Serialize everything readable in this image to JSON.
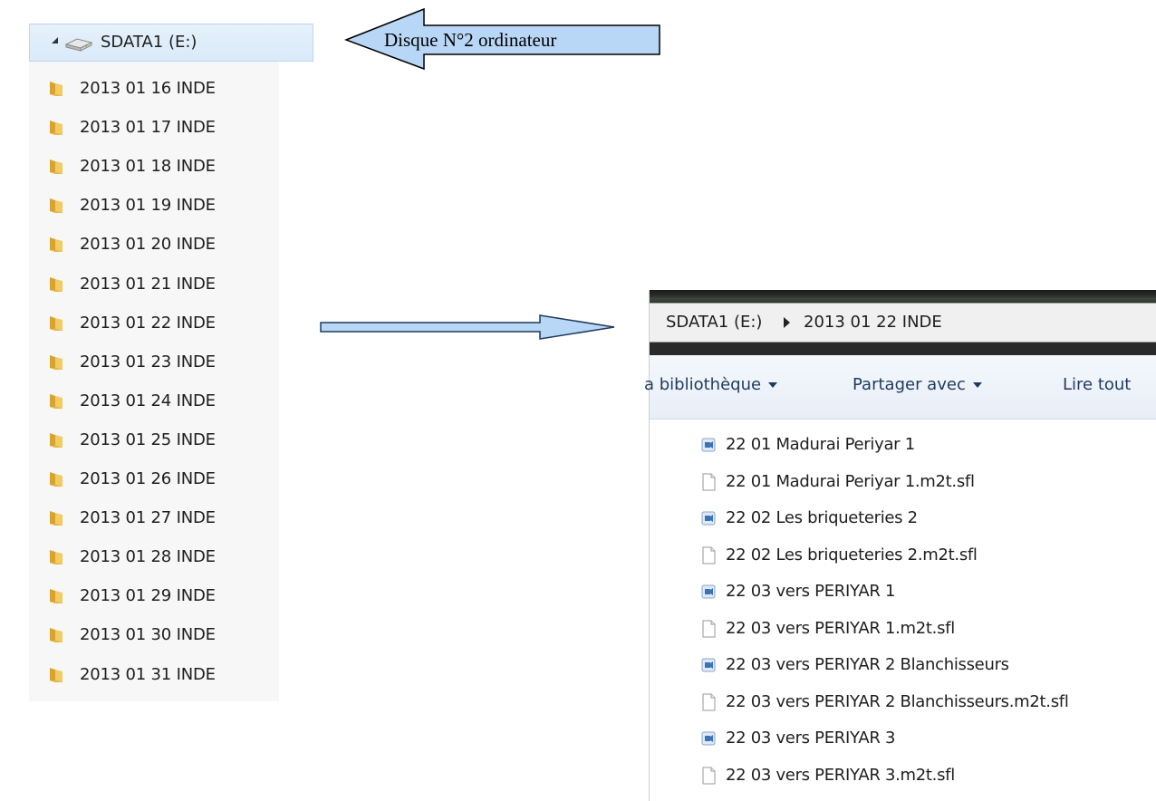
{
  "tree": {
    "drive_label": "SDATA1 (E:)",
    "folders": [
      "2013 01 16 INDE",
      "2013 01 17 INDE",
      "2013 01 18 INDE",
      "2013 01 19 INDE",
      "2013 01 20 INDE",
      "2013 01 21 INDE",
      "2013 01 22 INDE",
      "2013 01 23 INDE",
      "2013 01 24 INDE",
      "2013 01 25 INDE",
      "2013 01 26 INDE",
      "2013 01 27 INDE",
      "2013 01 28 INDE",
      "2013 01 29 INDE",
      "2013 01 30 INDE",
      "2013 01 31 INDE"
    ]
  },
  "callout": {
    "text": "Disque N°2 ordinateur"
  },
  "explorer": {
    "breadcrumb": [
      "SDATA1 (E:)",
      "2013 01 22 INDE"
    ],
    "toolbar": [
      "a bibliothèque",
      "Partager avec",
      "Lire tout"
    ],
    "files": [
      {
        "name": "22 01 Madurai Periyar 1",
        "icon": "video-file-icon"
      },
      {
        "name": "22 01 Madurai Periyar 1.m2t.sfl",
        "icon": "blank-file-icon"
      },
      {
        "name": "22 02 Les briqueteries 2",
        "icon": "video-file-icon"
      },
      {
        "name": "22 02 Les briqueteries 2.m2t.sfl",
        "icon": "blank-file-icon"
      },
      {
        "name": "22 03 vers PERIYAR 1",
        "icon": "video-file-icon"
      },
      {
        "name": "22 03 vers PERIYAR 1.m2t.sfl",
        "icon": "blank-file-icon"
      },
      {
        "name": "22 03 vers PERIYAR 2 Blanchisseurs",
        "icon": "video-file-icon"
      },
      {
        "name": "22 03 vers PERIYAR 2 Blanchisseurs.m2t.sfl",
        "icon": "blank-file-icon"
      },
      {
        "name": "22 03 vers PERIYAR 3",
        "icon": "video-file-icon"
      },
      {
        "name": "22 03 vers PERIYAR 3.m2t.sfl",
        "icon": "blank-file-icon"
      }
    ]
  }
}
